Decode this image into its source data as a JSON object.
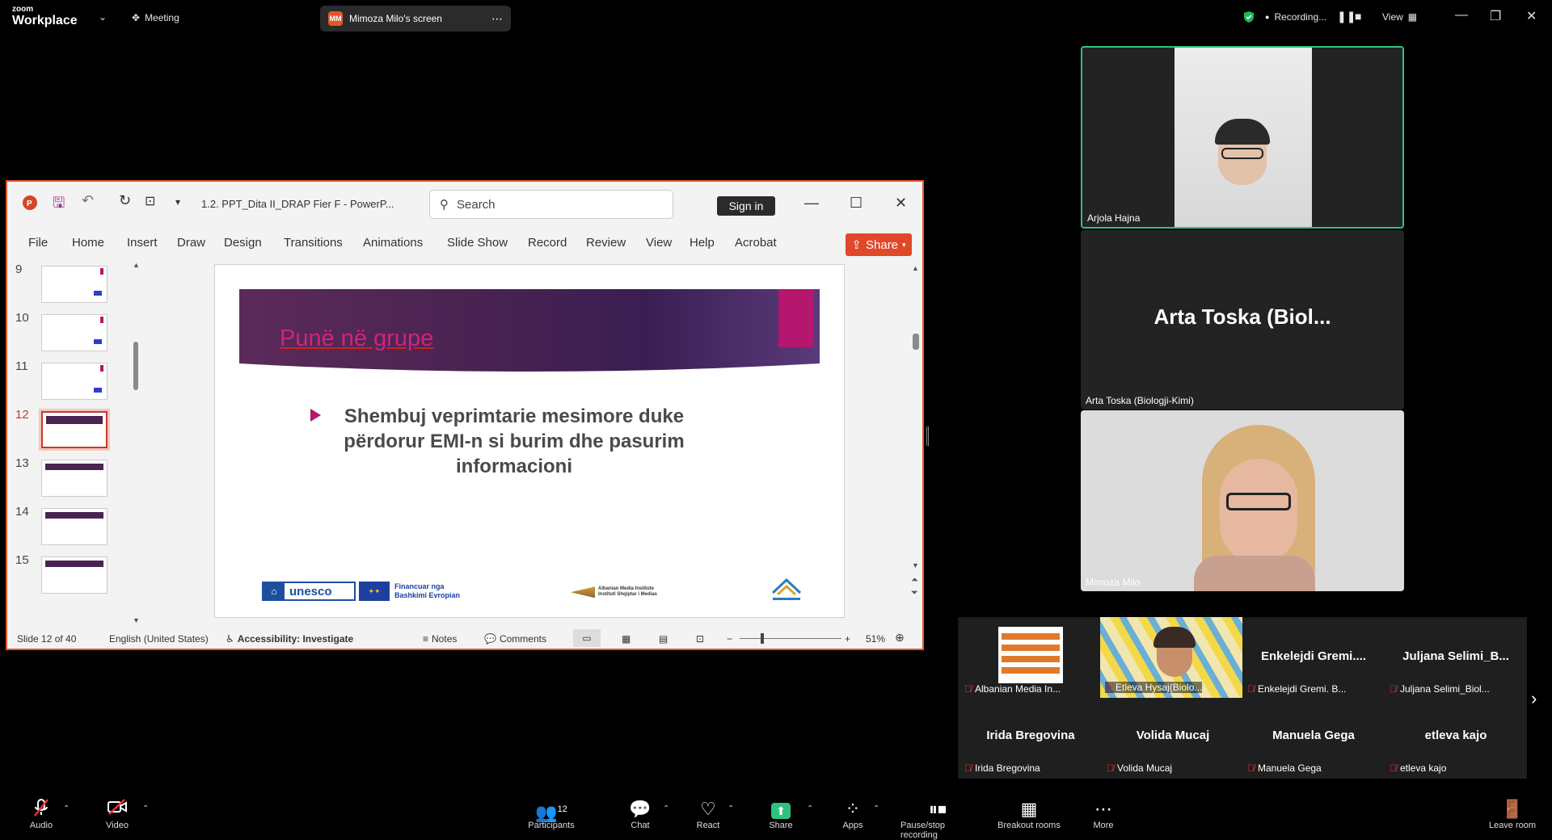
{
  "app": {
    "brand_top": "zoom",
    "brand_bottom": "Workplace"
  },
  "topbar": {
    "meeting_label": "Meeting",
    "screen_share_label": "Mimoza Milo's screen",
    "screen_share_badge": "MM",
    "recording_label": "Recording...",
    "view_label": "View"
  },
  "ppt": {
    "filename": "1.2. PPT_Dita II_DRAP Fier F  -  PowerP...",
    "search_placeholder": "Search",
    "sign_in": "Sign in",
    "share": "Share",
    "ribbon_tabs": [
      "File",
      "Home",
      "Insert",
      "Draw",
      "Design",
      "Transitions",
      "Animations",
      "Slide Show",
      "Record",
      "Review",
      "View",
      "Help",
      "Acrobat"
    ],
    "thumbnails": [
      "9",
      "10",
      "11",
      "12",
      "13",
      "14",
      "15"
    ],
    "active_slide": "12",
    "slide": {
      "title": "Punë në grupe",
      "bullet": "Shembuj veprimtarie mesimore duke përdorur EMI-n si burim dhe pasurim informacioni",
      "logo_unesco": "unesco",
      "logo_eu_line1": "Financuar nga",
      "logo_eu_line2": "Bashkimi Evropian",
      "logo_ami_line1": "Albanian Media Institute",
      "logo_ami_line2": "Instituti Shqiptar i Medias"
    },
    "status": {
      "slide_of": "Slide 12 of 40",
      "language": "English (United States)",
      "accessibility": "Accessibility: Investigate",
      "notes": "Notes",
      "comments": "Comments",
      "zoom": "51%"
    }
  },
  "participants_panel": {
    "tile1_name": "Arjola Hajna",
    "tile2_big": "Arta Toska (Biol...",
    "tile2_name": "Arta Toska (Biologji-Kimi)",
    "tile3_name": "Mimoza Milo",
    "gallery": [
      {
        "title": "",
        "name": "Albanian Media In..."
      },
      {
        "title": "",
        "name": "Etleva Hysaj(Biolo..."
      },
      {
        "title": "Enkelejdi  Gremi....",
        "name": "Enkelejdi Gremi. B..."
      },
      {
        "title": "Juljana  Selimi_B...",
        "name": "Juljana Selimi_Biol..."
      },
      {
        "title": "Irida Bregovina",
        "name": "Irida Bregovina"
      },
      {
        "title": "Volida Mucaj",
        "name": "Volida Mucaj"
      },
      {
        "title": "Manuela Gega",
        "name": "Manuela Gega"
      },
      {
        "title": "etleva kajo",
        "name": "etleva kajo"
      }
    ]
  },
  "toolbar": {
    "audio": "Audio",
    "video": "Video",
    "participants": "Participants",
    "participants_count": "12",
    "chat": "Chat",
    "react": "React",
    "share": "Share",
    "apps": "Apps",
    "pause_stop": "Pause/stop recording",
    "breakout": "Breakout rooms",
    "more": "More",
    "leave": "Leave room"
  }
}
